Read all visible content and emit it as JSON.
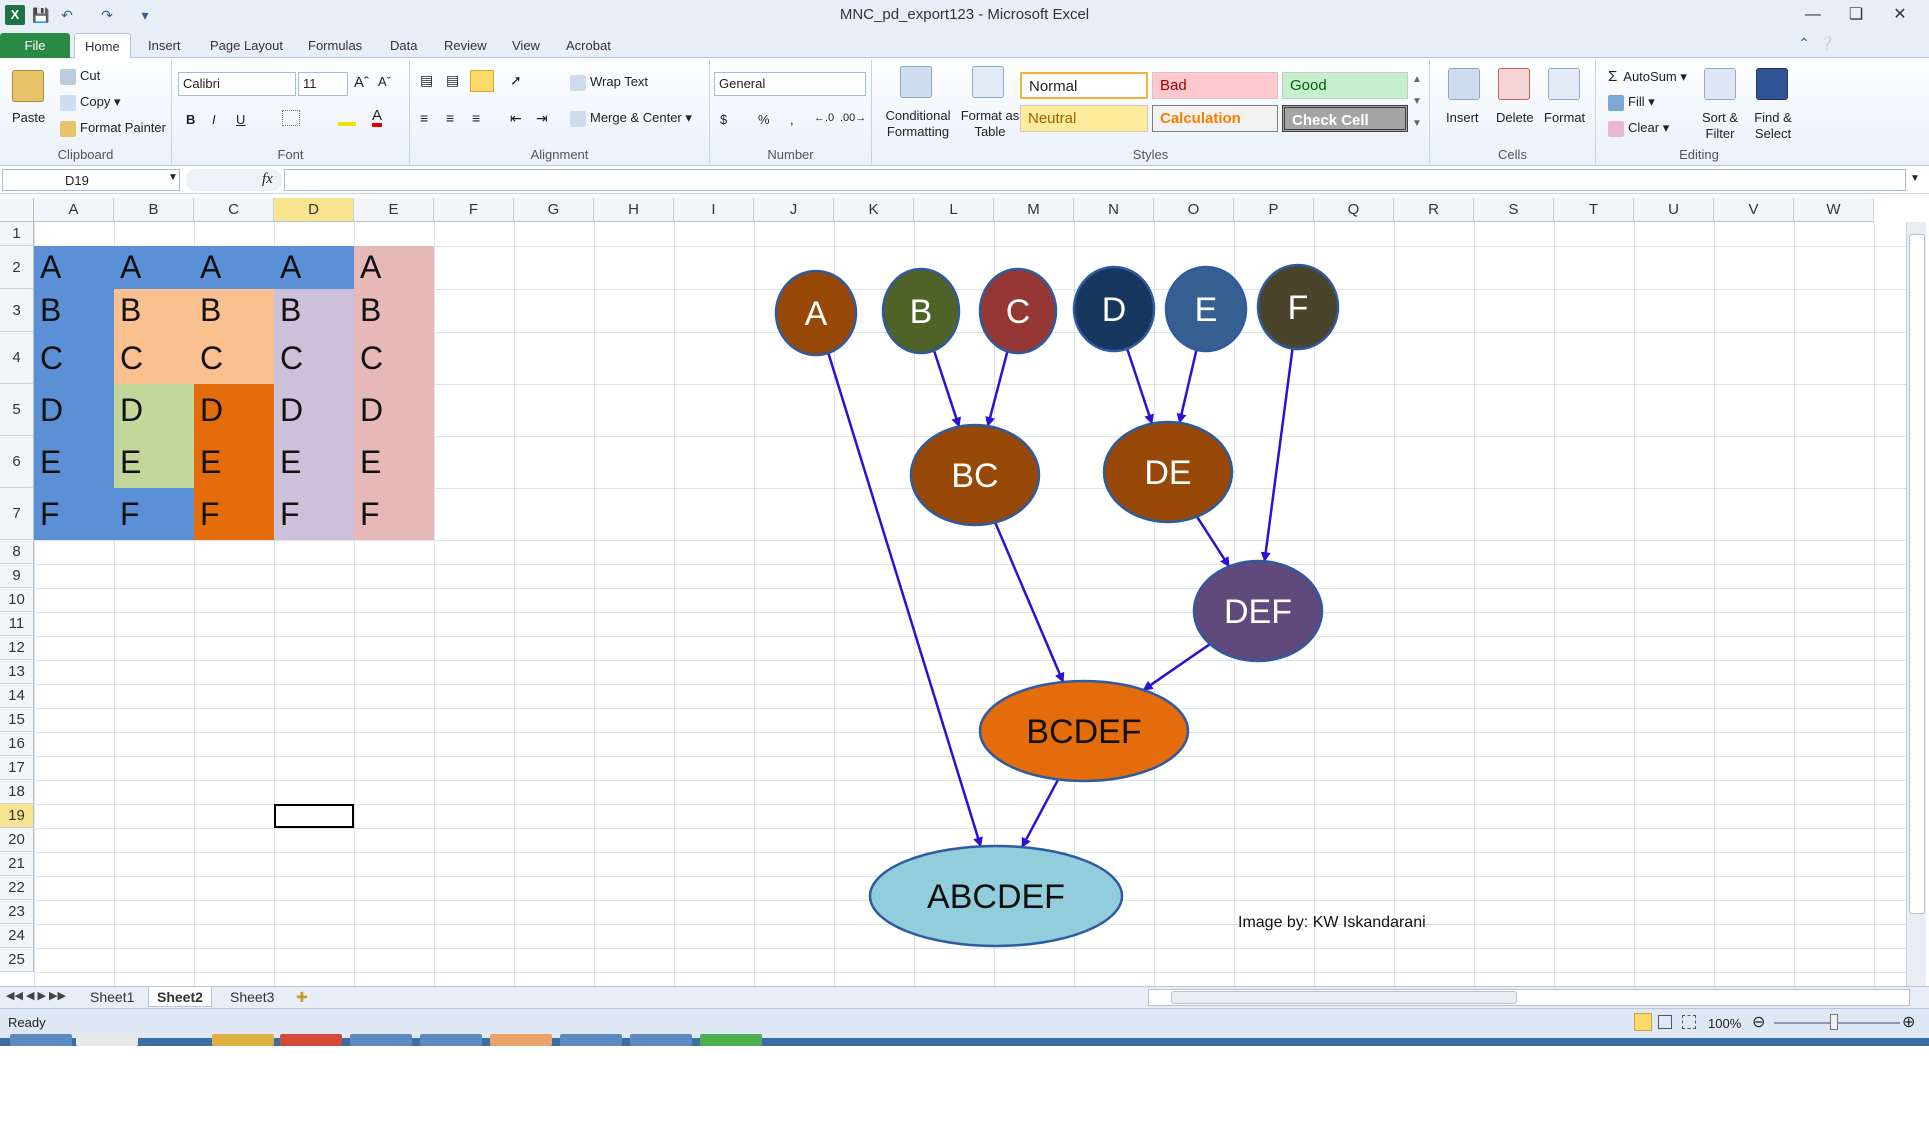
{
  "window": {
    "title": "MNC_pd_export123  -  Microsoft Excel"
  },
  "tabs": [
    "File",
    "Home",
    "Insert",
    "Page Layout",
    "Formulas",
    "Data",
    "Review",
    "View",
    "Acrobat"
  ],
  "ribbon": {
    "clipboard": {
      "paste": "Paste",
      "cut": "Cut",
      "copy": "Copy",
      "format_painter": "Format Painter",
      "label": "Clipboard"
    },
    "font": {
      "name": "Calibri",
      "size": "11",
      "bold": "B",
      "italic": "I",
      "underline": "U",
      "label": "Font"
    },
    "alignment": {
      "wrap": "Wrap Text",
      "merge": "Merge & Center",
      "label": "Alignment"
    },
    "number": {
      "format": "General",
      "currency": "$",
      "percent": "%",
      "comma": ",",
      "label": "Number"
    },
    "styles": {
      "conditional": "Conditional Formatting",
      "format_table": "Format as Table",
      "normal": "Normal",
      "bad": "Bad",
      "good": "Good",
      "neutral": "Neutral",
      "calculation": "Calculation",
      "check_cell": "Check Cell",
      "label": "Styles"
    },
    "cells": {
      "insert": "Insert",
      "delete": "Delete",
      "format": "Format",
      "label": "Cells"
    },
    "editing": {
      "autosum": "AutoSum",
      "fill": "Fill",
      "clear": "Clear",
      "sort": "Sort & Filter",
      "find": "Find & Select",
      "label": "Editing"
    }
  },
  "formula_bar": {
    "name_box": "D19",
    "fx": "fx",
    "value": ""
  },
  "columns": [
    "A",
    "B",
    "C",
    "D",
    "E",
    "F",
    "G",
    "H",
    "I",
    "J",
    "K",
    "L",
    "M",
    "N",
    "O",
    "P",
    "Q",
    "R",
    "S",
    "T",
    "U",
    "V",
    "W"
  ],
  "rows": [
    "1",
    "2",
    "3",
    "4",
    "5",
    "6",
    "7",
    "8",
    "9",
    "10",
    "11",
    "12",
    "13",
    "14",
    "15",
    "16",
    "17",
    "18",
    "19",
    "20",
    "21",
    "22",
    "23",
    "24",
    "25"
  ],
  "grid": [
    [
      "A",
      "A",
      "A",
      "A",
      "A"
    ],
    [
      "B",
      "B",
      "B",
      "B",
      "B"
    ],
    [
      "C",
      "C",
      "C",
      "C",
      "C"
    ],
    [
      "D",
      "D",
      "D",
      "D",
      "D"
    ],
    [
      "E",
      "E",
      "E",
      "E",
      "E"
    ],
    [
      "F",
      "F",
      "F",
      "F",
      "F"
    ]
  ],
  "grid_colors": [
    [
      "#5b8fd6",
      "#5b8fd6",
      "#5b8fd6",
      "#5b8fd6",
      "#e6b8b7"
    ],
    [
      "#5b8fd6",
      "#fac090",
      "#fac090",
      "#ccc0da",
      "#e6b8b7"
    ],
    [
      "#5b8fd6",
      "#fac090",
      "#fac090",
      "#ccc0da",
      "#e6b8b7"
    ],
    [
      "#5b8fd6",
      "#c4d79b",
      "#e46c0a",
      "#ccc0da",
      "#e6b8b7"
    ],
    [
      "#5b8fd6",
      "#c4d79b",
      "#e46c0a",
      "#ccc0da",
      "#e6b8b7"
    ],
    [
      "#5b8fd6",
      "#5b8fd6",
      "#e46c0a",
      "#ccc0da",
      "#e6b8b7"
    ]
  ],
  "diagram": {
    "nodes": [
      {
        "id": "A",
        "label": "A",
        "color": "#974806"
      },
      {
        "id": "B",
        "label": "B",
        "color": "#4f6228"
      },
      {
        "id": "C",
        "label": "C",
        "color": "#953735"
      },
      {
        "id": "D",
        "label": "D",
        "color": "#17375e"
      },
      {
        "id": "E",
        "label": "E",
        "color": "#376092"
      },
      {
        "id": "F",
        "label": "F",
        "color": "#4a452a"
      },
      {
        "id": "BC",
        "label": "BC",
        "color": "#974806"
      },
      {
        "id": "DE",
        "label": "DE",
        "color": "#974806"
      },
      {
        "id": "DEF",
        "label": "DEF",
        "color": "#604a7b"
      },
      {
        "id": "BCDEF",
        "label": "BCDEF",
        "color": "#e46c0a"
      },
      {
        "id": "ABCDEF",
        "label": "ABCDEF",
        "color": "#92cddc"
      }
    ],
    "edges": [
      [
        "B",
        "BC"
      ],
      [
        "C",
        "BC"
      ],
      [
        "D",
        "DE"
      ],
      [
        "E",
        "DE"
      ],
      [
        "DE",
        "DEF"
      ],
      [
        "F",
        "DEF"
      ],
      [
        "BC",
        "BCDEF"
      ],
      [
        "DEF",
        "BCDEF"
      ],
      [
        "A",
        "ABCDEF"
      ],
      [
        "BCDEF",
        "ABCDEF"
      ]
    ],
    "credit": "Image by: KW Iskandarani",
    "edge_color": "#2d10d6"
  },
  "sheets": [
    "Sheet1",
    "Sheet2",
    "Sheet3"
  ],
  "status": {
    "ready": "Ready",
    "zoom": "100%"
  }
}
